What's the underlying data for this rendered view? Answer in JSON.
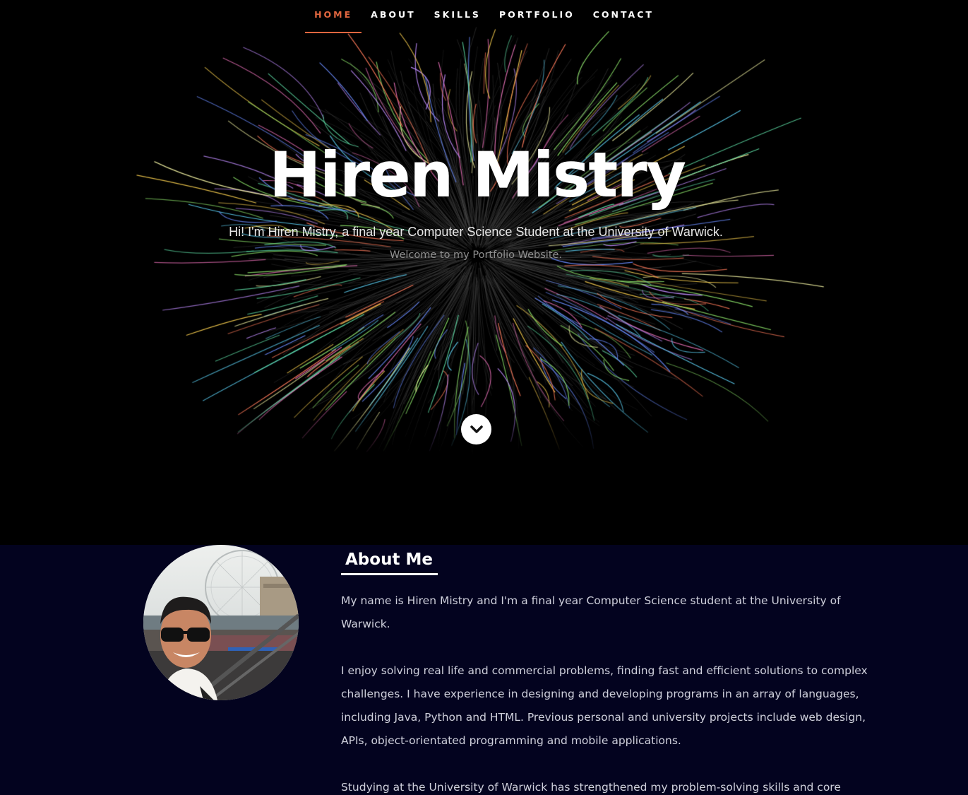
{
  "nav": {
    "items": [
      {
        "label": "HOME",
        "active": true
      },
      {
        "label": "ABOUT",
        "active": false
      },
      {
        "label": "SKILLS",
        "active": false
      },
      {
        "label": "PORTFOLIO",
        "active": false
      },
      {
        "label": "CONTACT",
        "active": false
      }
    ],
    "active_color": "#e0663f"
  },
  "hero": {
    "title": "Hiren Mistry",
    "intro": "Hi! I'm Hiren Mistry, a final year Computer Science Student at the University of Warwick.",
    "welcome": "Welcome to my Portfolio Website.",
    "scroll_icon": "chevron-down-icon"
  },
  "about": {
    "heading": "About Me",
    "paragraphs": [
      "My name is Hiren Mistry and I'm a final year Computer Science student at the University of Warwick.",
      "I enjoy solving real life and commercial problems, finding fast and efficient solutions to complex challenges. I have experience in designing and developing programs in an array of languages, including Java, Python and HTML. Previous personal and university projects include web design, APIs, object-orientated programming and mobile applications.",
      "Studying at the University of Warwick has strengthened my problem-solving skills and core"
    ]
  },
  "colors": {
    "hero_bg": "#000000",
    "about_bg": "#03031f",
    "accent": "#e0663f"
  }
}
